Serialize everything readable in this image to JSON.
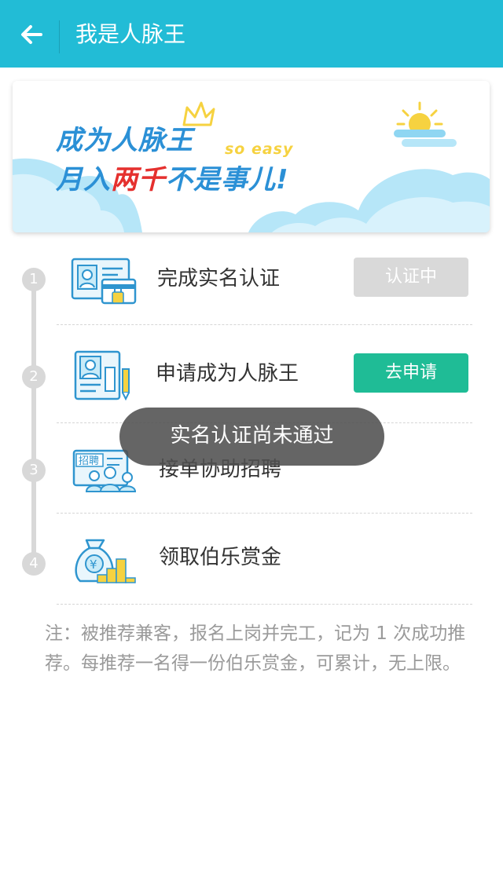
{
  "appbar": {
    "title": "我是人脉王",
    "back_icon": "arrow-left-icon"
  },
  "banner": {
    "line1": "成为人脉王",
    "line2_a": "月入",
    "line2_red": "两千",
    "line2_b": "不是事儿!",
    "tagline": "so easy",
    "colors": {
      "blue": "#2b90d6",
      "red": "#e5302e",
      "yellow": "#f6d240"
    }
  },
  "steps": [
    {
      "num": "1",
      "label": "完成实名认证",
      "icon": "id-card-lock-icon",
      "button": "认证中",
      "button_state": "disabled"
    },
    {
      "num": "2",
      "label": "申请成为人脉王",
      "icon": "resume-pencil-icon",
      "button": "去申请",
      "button_state": "enabled"
    },
    {
      "num": "3",
      "label": "接单协助招聘",
      "icon": "recruit-board-icon"
    },
    {
      "num": "4",
      "label": "领取伯乐赏金",
      "icon": "money-bag-coins-icon"
    }
  ],
  "note": "注：被推荐兼客，报名上岗并完工，记为 1 次成功推荐。每推荐一名得一份伯乐赏金，可累计，无上限。",
  "toast": "实名认证尚未通过",
  "colors": {
    "accent": "#22bcd6",
    "green_button": "#1fbc96",
    "gray_button": "#d9d9d9"
  }
}
